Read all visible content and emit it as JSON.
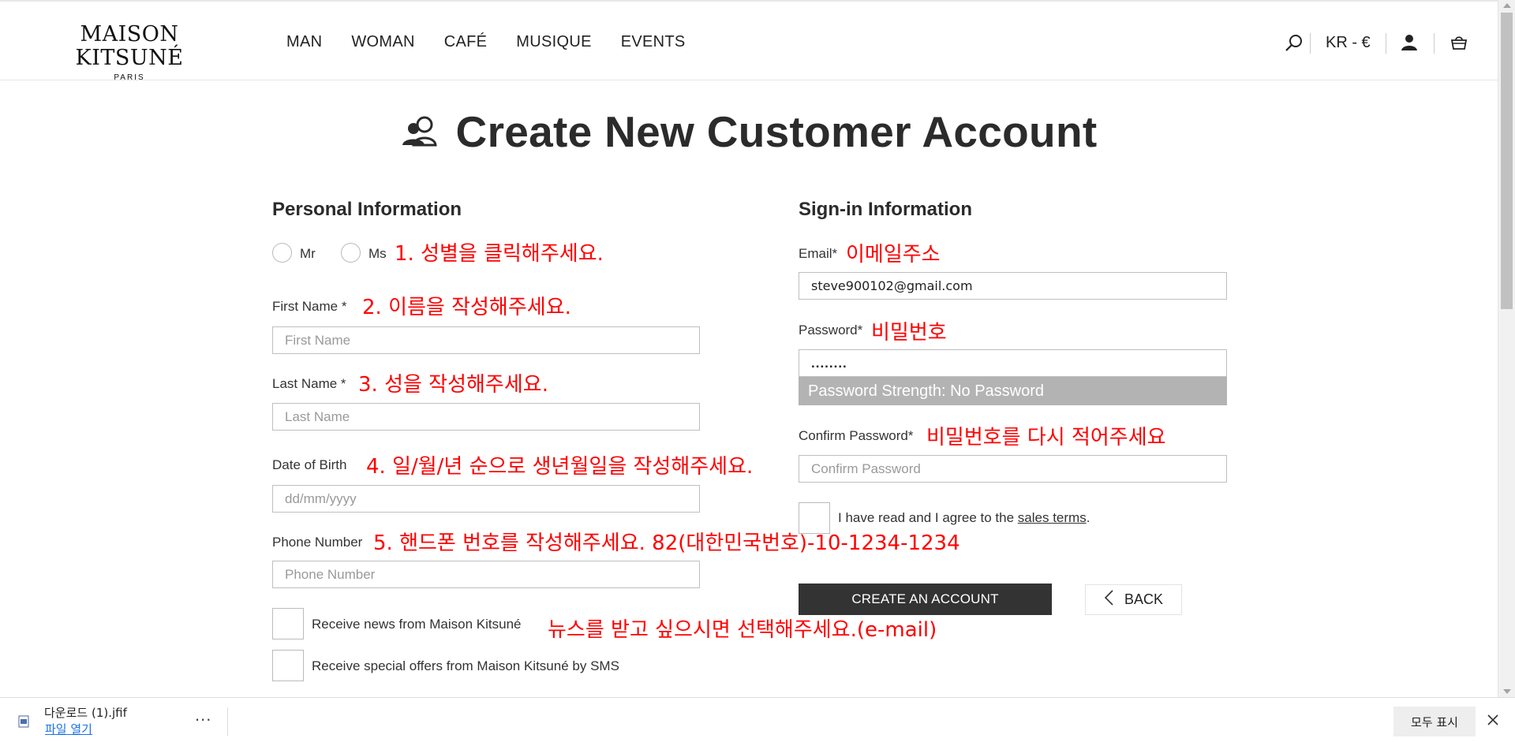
{
  "header": {
    "logo_main": "MAISON KITSUNÉ",
    "logo_sub": "PARIS",
    "nav": [
      "MAN",
      "WOMAN",
      "CAFÉ",
      "MUSIQUE",
      "EVENTS"
    ],
    "currency": "KR - €"
  },
  "page": {
    "title": "Create New Customer Account"
  },
  "personal": {
    "heading": "Personal Information",
    "mr": "Mr",
    "ms": "Ms",
    "first_name_label": "First Name *",
    "first_name_placeholder": "First Name",
    "last_name_label": "Last Name *",
    "last_name_placeholder": "Last Name",
    "dob_label": "Date of Birth",
    "dob_placeholder": "dd/mm/yyyy",
    "phone_label": "Phone Number",
    "phone_placeholder": "Phone Number",
    "news_label": "Receive news from Maison Kitsuné",
    "sms_label": "Receive special offers from Maison Kitsuné by SMS"
  },
  "signin": {
    "heading": "Sign-in Information",
    "email_label": "Email*",
    "email_value": "steve900102@gmail.com",
    "password_label": "Password*",
    "password_value": "........",
    "strength": "Password Strength: No Password",
    "confirm_label": "Confirm Password*",
    "confirm_placeholder": "Confirm Password",
    "terms_prefix": "I have read and I agree to the ",
    "terms_link": "sales terms",
    "terms_suffix": ".",
    "create_button": "CREATE AN ACCOUNT",
    "back_button": "BACK"
  },
  "annotations": {
    "gender": "1. 성별을 클릭해주세요.",
    "first_name": "2. 이름을 작성해주세요.",
    "last_name": "3. 성을 작성해주세요.",
    "dob": "4. 일/월/년 순으로 생년월일을 작성해주세요.",
    "phone": "5. 핸드폰 번호를 작성해주세요. 82(대한민국번호)-10-1234-1234",
    "news": "뉴스를 받고 싶으시면 선택해주세요.(e-mail)",
    "email": "이메일주소",
    "password": "비밀번호",
    "confirm": "비밀번호를 다시 적어주세요"
  },
  "download_bar": {
    "file_name": "다운로드 (1).jfif",
    "open_label": "파일 열기",
    "more": "...",
    "show_all": "모두 표시"
  }
}
